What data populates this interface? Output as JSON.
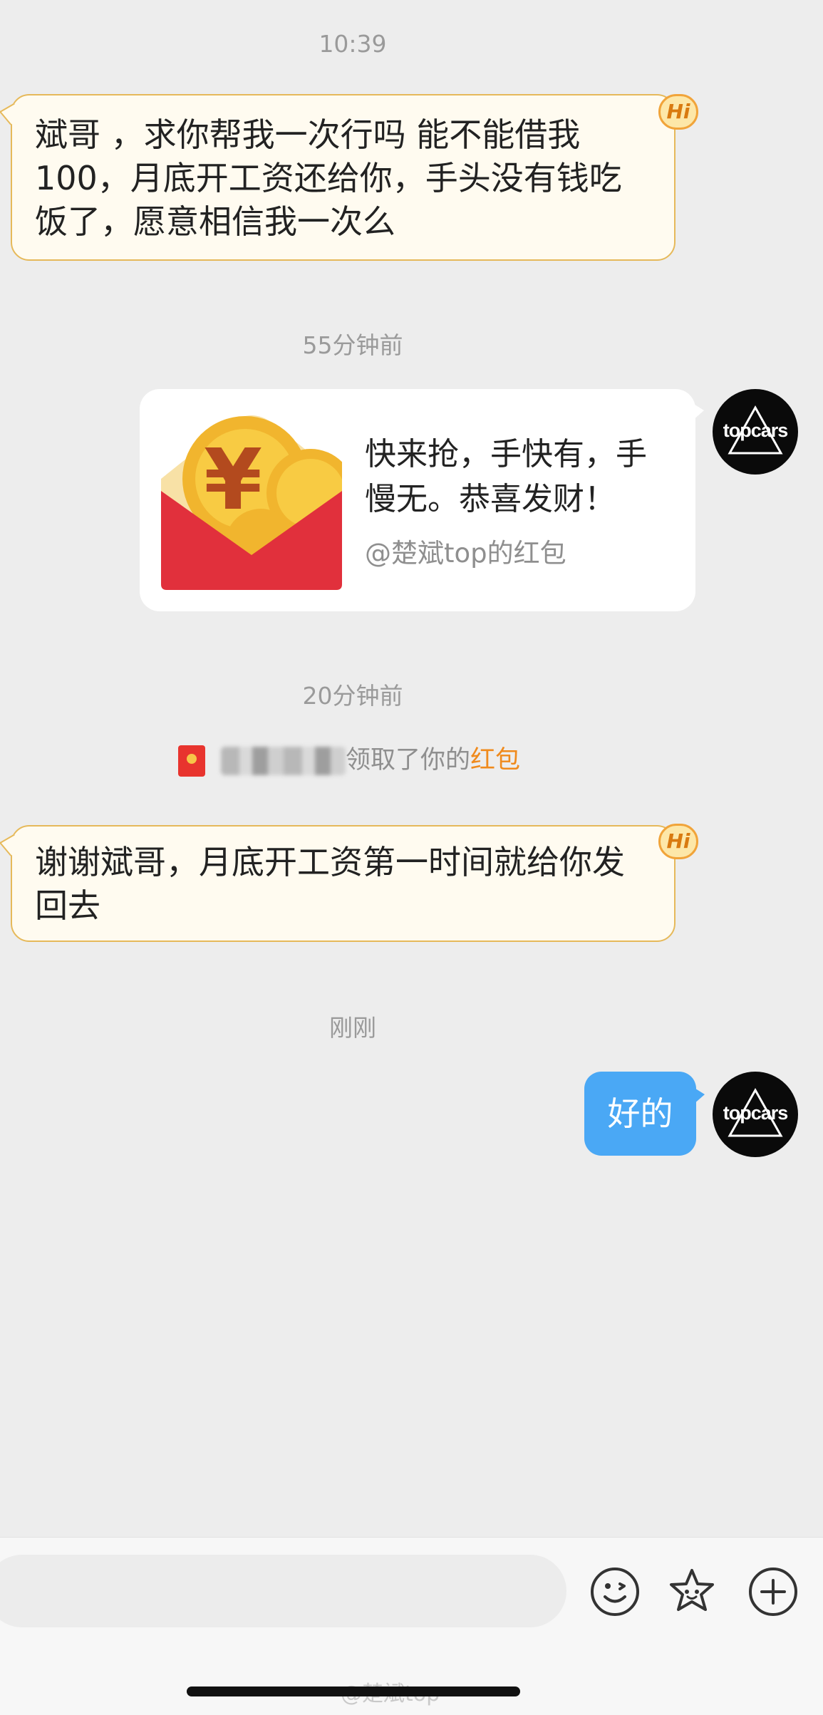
{
  "timestamps": {
    "first": "10:39",
    "second": "55分钟前",
    "third": "20分钟前",
    "fourth": "刚刚"
  },
  "messages": {
    "incoming_1": {
      "lines": [
        "斌哥 ，求你帮我一次行吗  能不能借我",
        "100，月底开工资还给你，手头没有钱吃",
        "饭了，愿意相信我一次么"
      ],
      "badge": "Hi"
    },
    "red_packet": {
      "title_line_1": "快来抢，手快有，手",
      "title_line_2": "慢无。恭喜发财！",
      "from": "@楚斌top的红包"
    },
    "notice": {
      "text": "领取了你的",
      "link": "红包"
    },
    "incoming_2": {
      "lines": [
        "谢谢斌哥，月底开工资第一时间就给你发",
        "回去"
      ],
      "badge": "Hi"
    },
    "outgoing_1": {
      "text": "好的"
    }
  },
  "avatar": {
    "label": "topcars"
  },
  "bottom_bar": {
    "input_value": "",
    "icons": [
      "emoji-icon",
      "sticker-icon",
      "plus-icon"
    ]
  },
  "watermark": "@楚斌top",
  "colors": {
    "background": "#ededed",
    "incoming_bubble": "#fffbf0",
    "incoming_border": "#e6b95a",
    "outgoing_bubble": "#4aa8f5",
    "red_envelope": "#e1303c",
    "notice_link": "#f08a1c"
  }
}
